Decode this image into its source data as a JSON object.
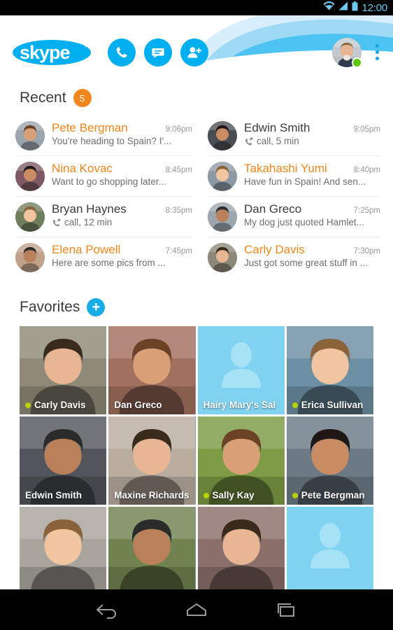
{
  "status_bar": {
    "time": "12:00",
    "icons": [
      "wifi-icon",
      "cellular-signal-icon",
      "battery-icon"
    ],
    "text_color": "#6ec9ef"
  },
  "header": {
    "logo_text": "skype",
    "logo_trademark": "TM",
    "brand_color": "#00AFF0",
    "actions": [
      {
        "name": "call-button",
        "icon": "phone-icon"
      },
      {
        "name": "chat-button",
        "icon": "chat-bubble-icon"
      },
      {
        "name": "add-contact-button",
        "icon": "add-person-icon"
      }
    ],
    "profile": {
      "name": "my-avatar",
      "presence": "online",
      "presence_color": "#5CC800"
    },
    "overflow_menu": "overflow-menu-icon"
  },
  "recent": {
    "title": "Recent",
    "badge": "5",
    "badge_color": "#F2861E",
    "left_column": [
      {
        "name": "Pete Bergman",
        "time": "9:06pm",
        "message": "You're heading to Spain? I'...",
        "unread": true,
        "type": "message",
        "avatar_color": "#9aa4ac"
      },
      {
        "name": "Nina Kovac",
        "time": "8:45pm",
        "message": "Want to go shopping later...",
        "unread": true,
        "type": "message",
        "avatar_color": "#7d5a63"
      },
      {
        "name": "Bryan Haynes",
        "time": "8:35pm",
        "message": "call, 12 min",
        "unread": false,
        "type": "call",
        "avatar_color": "#6f7f5e"
      },
      {
        "name": "Elena Powell",
        "time": "7:45pm",
        "message": "Here are some pics from ...",
        "unread": true,
        "type": "message",
        "avatar_color": "#c0a18a"
      }
    ],
    "right_column": [
      {
        "name": "Edwin Smith",
        "time": "9:05pm",
        "message": "call, 5 min",
        "unread": false,
        "type": "call",
        "avatar_color": "#4a4e52"
      },
      {
        "name": "Takahashi Yumi",
        "time": "8:40pm",
        "message": "Have fun in Spain! And sen...",
        "unread": true,
        "type": "message",
        "avatar_color": "#8d99a3"
      },
      {
        "name": "Dan Greco",
        "time": "7:25pm",
        "message": "My dog just quoted Hamlet...",
        "unread": false,
        "type": "message",
        "avatar_color": "#9ba6ae"
      },
      {
        "name": "Carly Davis",
        "time": "7:30pm",
        "message": "Just got some great stuff in ...",
        "unread": true,
        "type": "message",
        "avatar_color": "#8c8878"
      }
    ]
  },
  "favorites": {
    "title": "Favorites",
    "add_button": "+",
    "tiles": [
      {
        "label": "Carly Davis",
        "online": true,
        "placeholder": false,
        "tint": "#8e8a77"
      },
      {
        "label": "Dan Greco",
        "online": false,
        "placeholder": false,
        "tint": "#a2705f"
      },
      {
        "label": "Hairy Mary's Sal",
        "online": false,
        "placeholder": true,
        "tint": "#7FD2F0"
      },
      {
        "label": "Erica Sullivan",
        "online": true,
        "placeholder": false,
        "tint": "#6d8fa3"
      },
      {
        "label": "Edwin Smith",
        "online": false,
        "placeholder": false,
        "tint": "#52565c"
      },
      {
        "label": "Maxine Richards",
        "online": false,
        "placeholder": false,
        "tint": "#b9ada0"
      },
      {
        "label": "Sally Kay",
        "online": true,
        "placeholder": false,
        "tint": "#7d9c45"
      },
      {
        "label": "Pete Bergman",
        "online": true,
        "placeholder": false,
        "tint": "#6c7a86"
      },
      {
        "label": "",
        "online": false,
        "placeholder": false,
        "tint": "#a9a49c"
      },
      {
        "label": "",
        "online": false,
        "placeholder": false,
        "tint": "#70824f"
      },
      {
        "label": "",
        "online": false,
        "placeholder": false,
        "tint": "#8b6f6a"
      },
      {
        "label": "",
        "online": false,
        "placeholder": true,
        "tint": "#7FD2F0"
      }
    ]
  },
  "nav_bar": {
    "buttons": [
      {
        "name": "back-button",
        "icon": "back-arrow-icon"
      },
      {
        "name": "home-button",
        "icon": "home-icon"
      },
      {
        "name": "recents-button",
        "icon": "recent-apps-icon"
      }
    ]
  }
}
